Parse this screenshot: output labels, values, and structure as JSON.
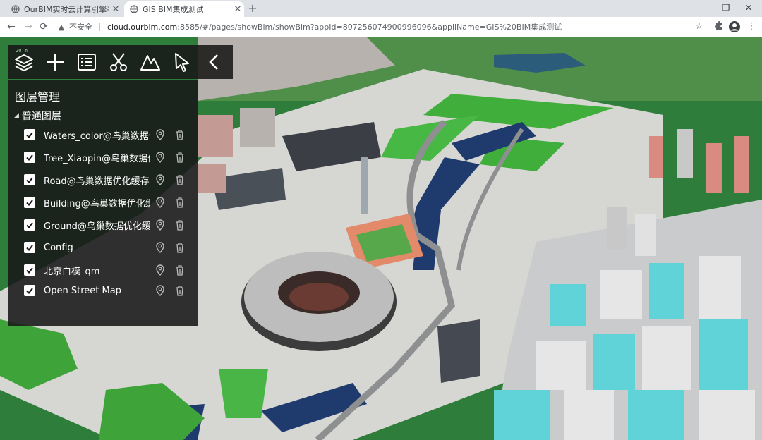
{
  "browser": {
    "tabs": [
      {
        "title": "OurBIM实时云计算引擎平台",
        "active": false
      },
      {
        "title": "GIS BIM集成测试",
        "active": true
      }
    ],
    "new_tab": "+",
    "window_controls": {
      "minimize": "—",
      "maximize": "❐",
      "close": "✕"
    },
    "nav": {
      "back": "←",
      "forward": "→",
      "reload": "⟳"
    },
    "address": {
      "security_label": "不安全",
      "host": "cloud.ourbim.com",
      "rest": ":8585/#/pages/showBim/showBim?appId=807256074900996096&appliName=GIS%20BIM集成测试"
    }
  },
  "gis_toolbar": {
    "tools": [
      "layers-icon",
      "add-icon",
      "list-icon",
      "cut-icon",
      "terrain-icon",
      "select-pointer-icon",
      "collapse-icon"
    ],
    "scale": "20 m"
  },
  "layer_panel": {
    "title": "图层管理",
    "group": "普通图层",
    "layers": [
      {
        "name": "Waters_color@鸟巢数据优化缓存",
        "checked": true
      },
      {
        "name": "Tree_Xiaopin@鸟巢数据优化缓存",
        "checked": true
      },
      {
        "name": "Road@鸟巢数据优化缓存",
        "checked": true
      },
      {
        "name": "Building@鸟巢数据优化缓存",
        "checked": true
      },
      {
        "name": "Ground@鸟巢数据优化缓存",
        "checked": true
      },
      {
        "name": "Config",
        "checked": true
      },
      {
        "name": "北京白模_qm",
        "checked": true
      },
      {
        "name": "Open Street Map",
        "checked": true
      }
    ]
  },
  "colors": {
    "panel_bg": "#181818",
    "grass": "#3fae3a",
    "water": "#1f3b6e",
    "building_teal": "#5fd3d8",
    "plaza": "#d6d6d2"
  }
}
